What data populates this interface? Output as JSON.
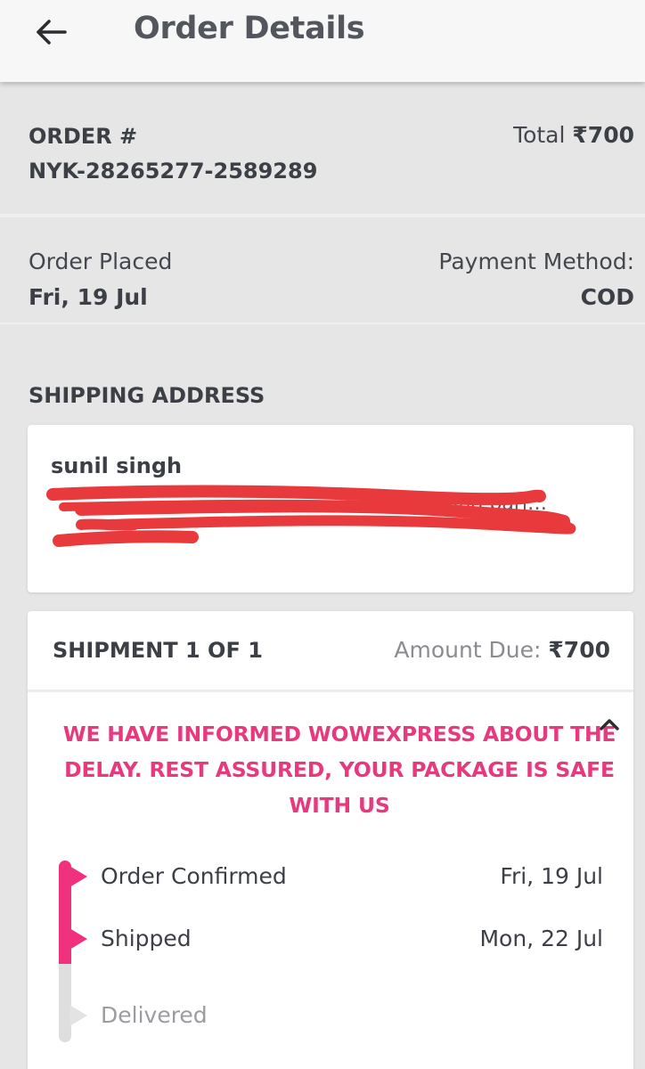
{
  "header": {
    "title": "Order Details",
    "back_icon": "arrow-left-icon"
  },
  "order": {
    "label": "ORDER #",
    "number": "NYK-28265277-2589289",
    "total_label": "Total",
    "total_value": "₹700"
  },
  "placed": {
    "label": "Order Placed",
    "date": "Fri, 19 Jul",
    "payment_label": "Payment Method:",
    "payment_value": "COD"
  },
  "shipping": {
    "heading": "SHIPPING ADDRESS",
    "name": "sunil singh",
    "address_line_visible_end": "ool and pari…"
  },
  "shipment": {
    "title": "SHIPMENT 1 OF 1",
    "amount_label": "Amount Due:",
    "amount_value": "₹700",
    "alert_lines": [
      "WE HAVE INFORMED WOWEXPRESS ABOUT THE",
      "DELAY. REST ASSURED, YOUR PACKAGE IS SAFE",
      "WITH US"
    ],
    "collapse_icon": "chevron-up-icon",
    "steps": [
      {
        "label": "Order Confirmed",
        "date": "Fri, 19 Jul",
        "done": true
      },
      {
        "label": "Shipped",
        "date": "Mon, 22 Jul",
        "done": true
      },
      {
        "label": "Delivered",
        "date": "",
        "done": false
      }
    ]
  },
  "colors": {
    "accent": "#e8397e",
    "progress_done": "#f0317d",
    "progress_pending": "#dedede",
    "redaction": "#e8393c"
  }
}
